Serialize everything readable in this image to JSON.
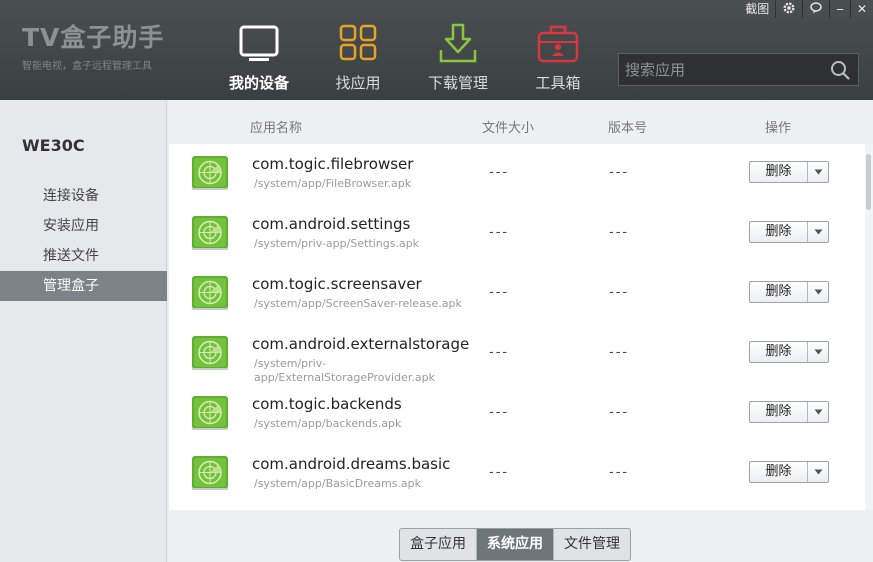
{
  "brand": {
    "logo": "TV盒子助手",
    "subtitle": "智能电视，盒子远程管理工具"
  },
  "window_controls": {
    "screenshot": "截图",
    "settings_icon": "gear-icon",
    "feedback_icon": "chat-icon",
    "minimize": "‒",
    "close": "✕"
  },
  "nav": {
    "items": [
      {
        "label": "我的设备",
        "icon": "tablet-icon",
        "active": true
      },
      {
        "label": "找应用",
        "icon": "grid-icon",
        "active": false
      },
      {
        "label": "下载管理",
        "icon": "download-icon",
        "active": false
      },
      {
        "label": "工具箱",
        "icon": "toolbox-icon",
        "active": false
      }
    ]
  },
  "search": {
    "placeholder": "搜索应用",
    "value": ""
  },
  "sidebar": {
    "device_name": "WE30C",
    "items": [
      {
        "label": "连接设备",
        "active": false
      },
      {
        "label": "安装应用",
        "active": false
      },
      {
        "label": "推送文件",
        "active": false
      },
      {
        "label": "管理盒子",
        "active": true
      }
    ]
  },
  "table": {
    "headers": {
      "name": "应用名称",
      "size": "文件大小",
      "version": "版本号",
      "action": "操作"
    },
    "rows": [
      {
        "name": "com.togic.filebrowser",
        "path": "/system/app/FileBrowser.apk",
        "size": "---",
        "version": "---",
        "action": "删除"
      },
      {
        "name": "com.android.settings",
        "path": "/system/priv-app/Settings.apk",
        "size": "---",
        "version": "---",
        "action": "删除"
      },
      {
        "name": "com.togic.screensaver",
        "path": "/system/app/ScreenSaver-release.apk",
        "size": "---",
        "version": "---",
        "action": "删除"
      },
      {
        "name": "com.android.externalstorage",
        "path": "/system/priv-app/ExternalStorageProvider.apk",
        "size": "---",
        "version": "---",
        "action": "删除"
      },
      {
        "name": "com.togic.backends",
        "path": "/system/app/backends.apk",
        "size": "---",
        "version": "---",
        "action": "删除"
      },
      {
        "name": "com.android.dreams.basic",
        "path": "/system/app/BasicDreams.apk",
        "size": "---",
        "version": "---",
        "action": "删除"
      }
    ]
  },
  "tabs": [
    {
      "label": "盒子应用",
      "active": false
    },
    {
      "label": "系统应用",
      "active": true
    },
    {
      "label": "文件管理",
      "active": false
    }
  ],
  "colors": {
    "header_bg": "#3f4446",
    "accent_orange": "#e8a227",
    "accent_green": "#8bc53f",
    "accent_red": "#d9363e",
    "sidebar_active": "#7c8386",
    "app_icon_green": "#6fbf3a"
  }
}
